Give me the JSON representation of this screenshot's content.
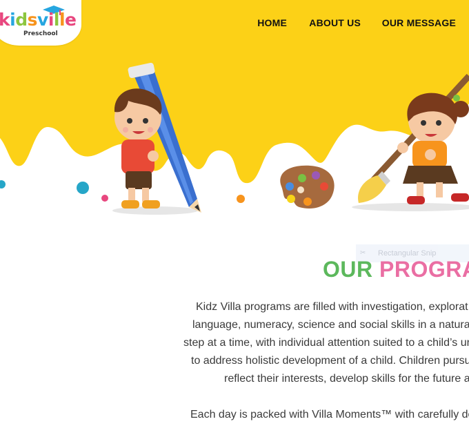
{
  "logo": {
    "letters": [
      {
        "ch": "k",
        "color": "#e8477f"
      },
      {
        "ch": "i",
        "color": "#26a6e0"
      },
      {
        "ch": "d",
        "color": "#8dc63f"
      },
      {
        "ch": "s",
        "color": "#f7941d"
      },
      {
        "ch": "v",
        "color": "#26a6e0"
      },
      {
        "ch": "i",
        "color": "#e8477f"
      },
      {
        "ch": "l",
        "color": "#8dc63f"
      },
      {
        "ch": "l",
        "color": "#f7941d"
      },
      {
        "ch": "e",
        "color": "#e8477f"
      }
    ],
    "subtitle": "Preschool"
  },
  "nav": {
    "items": [
      "HOME",
      "ABOUT US",
      "OUR MESSAGE"
    ]
  },
  "overlay": {
    "snip_label": "Rectangular Snip"
  },
  "section": {
    "title_part1": "OUR",
    "title_part2": "PROGRA",
    "lines": [
      "Kidz Villa programs are filled with investigation, explorat",
      "language, numeracy, science and social skills in a natura",
      "step at a time, with individual attention suited to a child’s ur",
      "to address holistic development of a child. Children pursu",
      "reflect their interests, develop skills for the future a",
      "Each day is packed with Villa Moments™ with carefully de"
    ]
  },
  "colors": {
    "hero_yellow": "#fcd117",
    "title_green": "#5cb85c",
    "title_pink": "#ea6ea3"
  }
}
